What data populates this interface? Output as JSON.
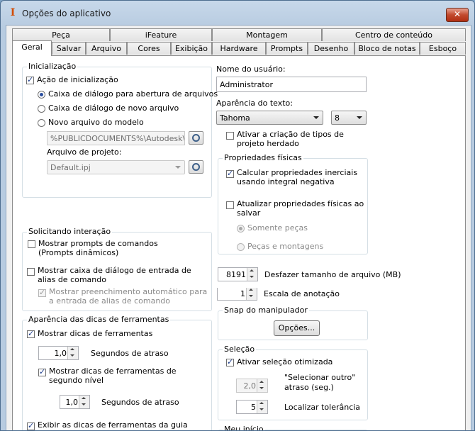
{
  "window": {
    "title": "Opções do aplicativo",
    "close_glyph": "✕"
  },
  "tabs_row1": [
    "Peça",
    "iFeature",
    "Montagem",
    "Centro de conteúdo"
  ],
  "tabs_row2": [
    "Geral",
    "Salvar",
    "Arquivo",
    "Cores",
    "Exibição",
    "Hardware",
    "Prompts",
    "Desenho",
    "Bloco de notas",
    "Esboço"
  ],
  "startup": {
    "title": "Inicialização",
    "action_label": "Ação de inicialização",
    "action_checked": true,
    "opt_open": "Caixa de diálogo para abertura de arquivos",
    "opt_new": "Caixa de diálogo de novo arquivo",
    "opt_template": "Novo arquivo do modelo",
    "template_path": "%PUBLICDOCUMENTS%\\Autodesk\\Inv",
    "project_label": "Arquivo de projeto:",
    "project_value": "Default.ipj"
  },
  "prompting": {
    "title": "Solicitando interação",
    "show_prompts": "Mostrar prompts de comandos (Prompts dinâmicos)",
    "show_alias": "Mostrar caixa de diálogo de entrada de alias de comando",
    "autocomplete": "Mostrar preenchimento automático para a entrada de alias de comando"
  },
  "tooltips": {
    "title": "Aparência das dicas de ferramentas",
    "show_tooltips": "Mostrar dicas de ferramentas",
    "delay1_value": "1,0",
    "delay_label": "Segundos de atraso",
    "show_second": "Mostrar dicas de ferramentas de segundo nível",
    "delay2_value": "1,0",
    "show_guide": "Exibir as dicas de ferramentas da guia documento"
  },
  "user": {
    "label": "Nome do usuário:",
    "value": "Administrator"
  },
  "text_appearance": {
    "label": "Aparência do texto:",
    "font": "Tahoma",
    "size": "8"
  },
  "legacy": {
    "label": "Ativar a criação de tipos de projeto herdado"
  },
  "physical": {
    "title": "Propriedades físicas",
    "calc_label": "Calcular propriedades inerciais usando integral negativa",
    "update_label": "Atualizar propriedades físicas ao salvar",
    "parts_only": "Somente peças",
    "parts_assemblies": "Peças e montagens"
  },
  "undo": {
    "value": "8191",
    "label": "Desfazer tamanho de arquivo (MB)"
  },
  "annotation": {
    "value": "1",
    "label": "Escala de anotação"
  },
  "manipulator": {
    "title": "Snap do manipulador",
    "button": "Opções..."
  },
  "selection": {
    "title": "Seleção",
    "optimized": "Ativar seleção otimizada",
    "select_other_value": "2,0",
    "select_other_label_1": "\"Selecionar outro\"",
    "select_other_label_2": "atraso (seg.)",
    "tolerance_value": "5",
    "tolerance_label": "Localizar tolerância"
  },
  "my_home": {
    "title": "Meu início"
  }
}
